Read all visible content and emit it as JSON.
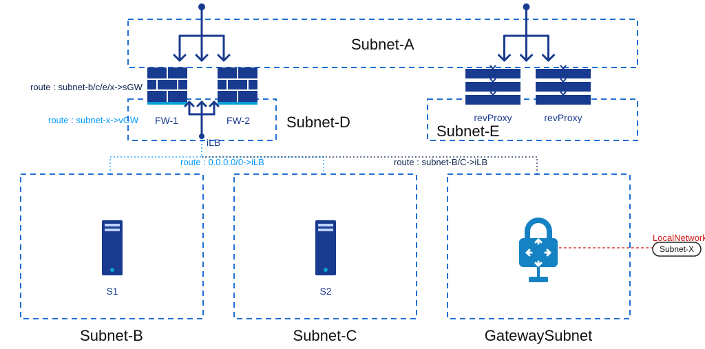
{
  "subnets": {
    "a": "Subnet-A",
    "d": "Subnet-D",
    "e": "Subnet-E",
    "b": "Subnet-B",
    "c": "Subnet-C",
    "gw": "GatewaySubnet"
  },
  "firewalls": {
    "left": "FW-1",
    "right": "FW-2"
  },
  "ilb": "iLB",
  "revproxy": {
    "left": "revProxy",
    "right": "revProxy"
  },
  "servers": {
    "s1": "S1",
    "s2": "S2"
  },
  "routes": {
    "r1": "route : subnet-b/c/e/x->sGW",
    "r2": "route : subnet-x->vGW",
    "r3_left": "route : 0.0.0.0/0->iLB",
    "r3_right": "route : subnet-B/C->iLB"
  },
  "local_gateway": "LocalNetworkGateway",
  "subnet_x": "Subnet-X",
  "colors": {
    "primary": "#183a8f",
    "subnet_border": "#1f6fd4",
    "route_default": "#0099ff",
    "route_dark": "#08214a",
    "red": "#d01616"
  }
}
